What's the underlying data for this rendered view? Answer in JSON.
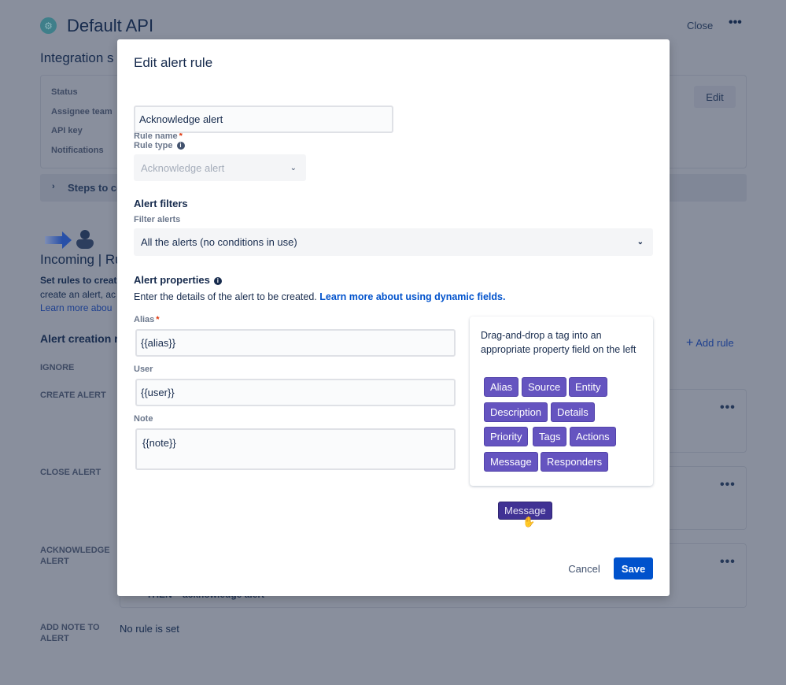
{
  "background": {
    "title": "Default API",
    "close_label": "Close",
    "more_icon": "more-icon",
    "integration_heading": "Integration s",
    "settings_labels": [
      "Status",
      "Assignee team",
      "API key",
      "Notifications"
    ],
    "edit_label": "Edit",
    "steps_label": "Steps to co",
    "incoming_heading": "Incoming | Ru",
    "set_rules_text": "Set rules to creat",
    "create_text": "create an alert, ac",
    "learn_more": "Learn more abou",
    "alert_creation_heading": "Alert creation r",
    "add_rule_label": "Add rule",
    "rule_types": [
      "IGNORE",
      "CREATE ALERT",
      "CLOSE ALERT",
      "ACKNOWLEDGE ALERT",
      "ADD NOTE TO ALERT"
    ],
    "then_text": "THEN    acknowledge alert",
    "no_rule_text": "No rule is set"
  },
  "modal": {
    "title": "Edit alert rule",
    "rule_name_label": "Rule name",
    "rule_name_value": "Acknowledge alert",
    "rule_type_label": "Rule type",
    "rule_type_value": "Acknowledge alert",
    "alert_filters_heading": "Alert filters",
    "filter_alerts_label": "Filter alerts",
    "filter_alerts_value": "All the alerts (no conditions in use)",
    "alert_properties_heading": "Alert properties",
    "properties_description": "Enter the details of the alert to be created.",
    "properties_link": "Learn more about using dynamic fields.",
    "alias_label": "Alias",
    "alias_value": "{{alias}}",
    "user_label": "User",
    "user_value": "{{user}}",
    "note_label": "Note",
    "note_value": "{{note}}",
    "tag_hint": "Drag-and-drop a tag into an appropriate property field on the left",
    "tags": [
      "Alias",
      "Source",
      "Entity",
      "Description",
      "Details",
      "Priority",
      "Tags",
      "Actions",
      "Message",
      "Responders"
    ],
    "dragging_tag": "Message",
    "cancel_label": "Cancel",
    "save_label": "Save"
  },
  "colors": {
    "tag": "#6554c0",
    "primary": "#0052cc",
    "link": "#0052cc",
    "drag_tag": "#403294"
  }
}
